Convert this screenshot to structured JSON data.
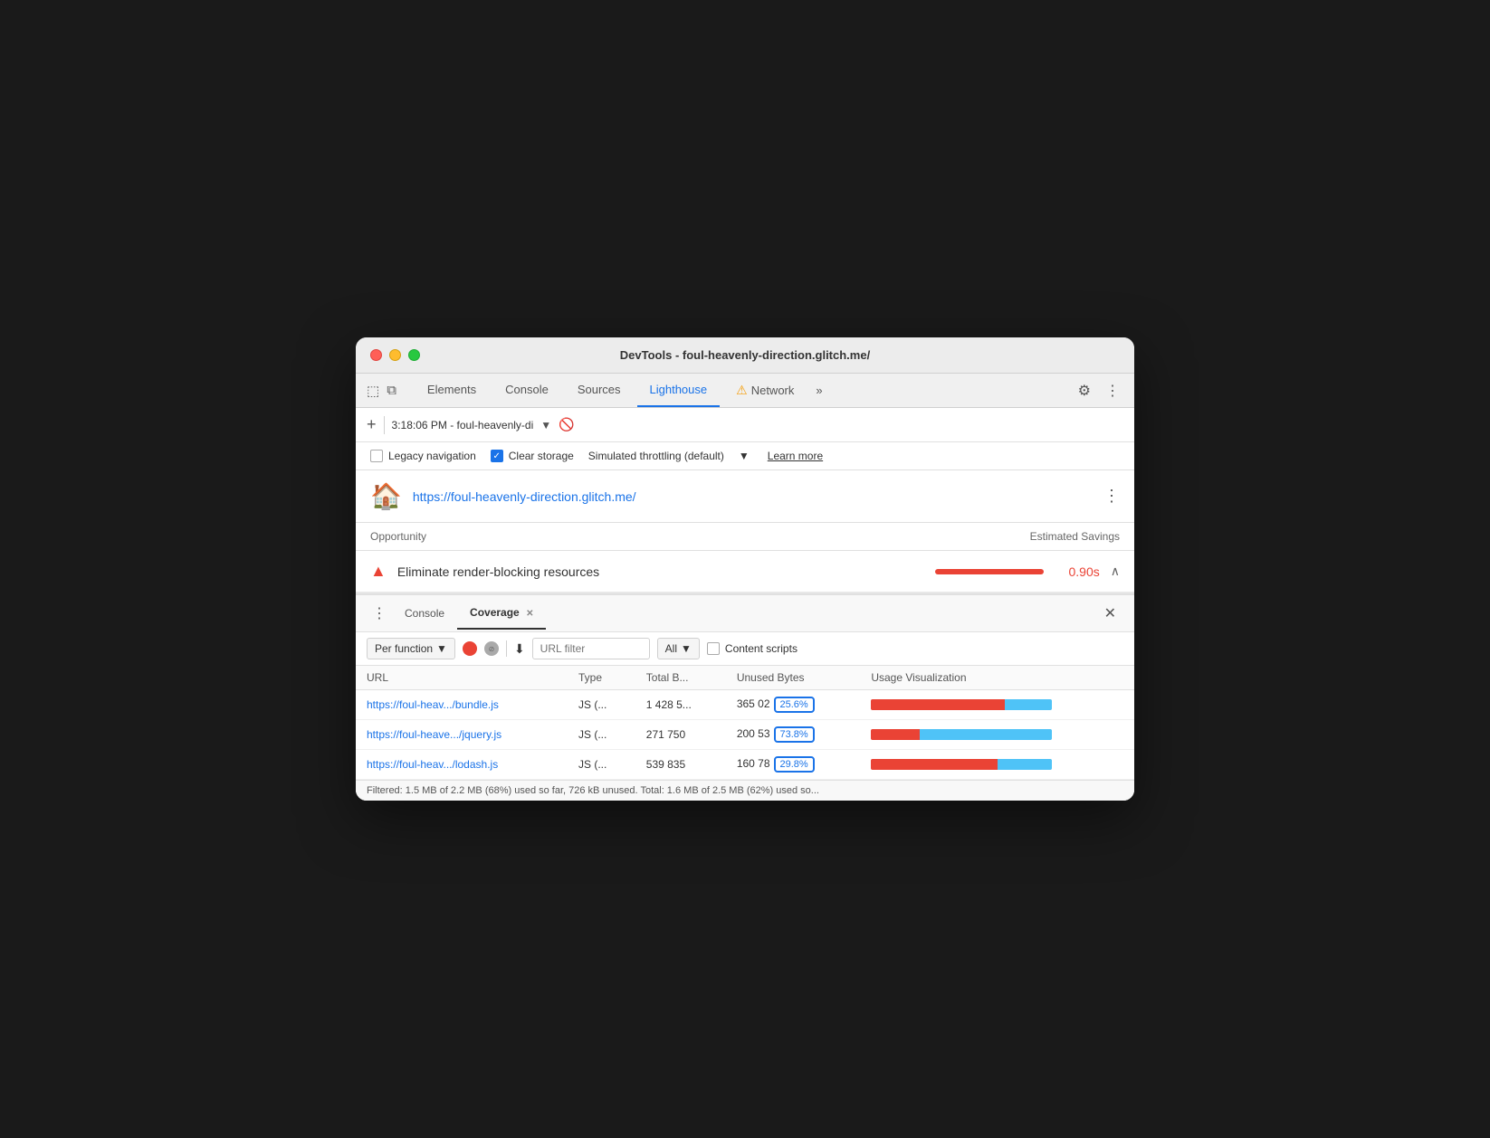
{
  "window": {
    "title": "DevTools - foul-heavenly-direction.glitch.me/"
  },
  "traffic_lights": {
    "red_label": "close",
    "yellow_label": "minimize",
    "green_label": "maximize"
  },
  "tabs": [
    {
      "id": "elements",
      "label": "Elements",
      "active": false
    },
    {
      "id": "console",
      "label": "Console",
      "active": false
    },
    {
      "id": "sources",
      "label": "Sources",
      "active": false
    },
    {
      "id": "lighthouse",
      "label": "Lighthouse",
      "active": true
    },
    {
      "id": "network",
      "label": "Network",
      "active": false
    }
  ],
  "toolbar": {
    "time": "3:18:06 PM - foul-heavenly-di",
    "add_label": "+",
    "stop_icon": "🚫"
  },
  "options": {
    "legacy_nav_label": "Legacy navigation",
    "legacy_nav_checked": false,
    "clear_storage_label": "Clear storage",
    "clear_storage_checked": true,
    "throttling_label": "Simulated throttling (default)",
    "learn_more_label": "Learn more"
  },
  "lighthouse_header": {
    "url": "https://foul-heavenly-direction.glitch.me/"
  },
  "opportunity": {
    "header_label": "Opportunity",
    "savings_label": "Estimated Savings",
    "item_label": "Eliminate render-blocking resources",
    "time": "0.90s"
  },
  "coverage_panel": {
    "tabs": [
      {
        "id": "console-tab",
        "label": "Console",
        "active": false,
        "closeable": false
      },
      {
        "id": "coverage-tab",
        "label": "Coverage",
        "active": true,
        "closeable": true
      }
    ],
    "per_function_label": "Per function",
    "url_filter_placeholder": "URL filter",
    "filter_all_label": "All",
    "content_scripts_label": "Content scripts",
    "table": {
      "columns": [
        "URL",
        "Type",
        "Total B...",
        "Unused Bytes",
        "Usage Visualization"
      ],
      "rows": [
        {
          "url": "https://foul-heav.../bundle.js",
          "type": "JS (...",
          "total": "1 428 5...",
          "unused": "365 02",
          "percent": "25.6%",
          "used_pct": 74,
          "unused_pct": 26
        },
        {
          "url": "https://foul-heave.../jquery.js",
          "type": "JS (...",
          "total": "271 750",
          "unused": "200 53",
          "percent": "73.8%",
          "used_pct": 27,
          "unused_pct": 73
        },
        {
          "url": "https://foul-heav.../lodash.js",
          "type": "JS (...",
          "total": "539 835",
          "unused": "160 78",
          "percent": "29.8%",
          "used_pct": 70,
          "unused_pct": 30
        }
      ]
    }
  },
  "status_bar": {
    "text": "Filtered: 1.5 MB of 2.2 MB (68%) used so far, 726 kB unused. Total: 1.6 MB of 2.5 MB (62%) used so..."
  },
  "colors": {
    "accent_blue": "#1a73e8",
    "red": "#ea4335",
    "cyan": "#4fc3f7",
    "warning_orange": "#f59e0b"
  }
}
